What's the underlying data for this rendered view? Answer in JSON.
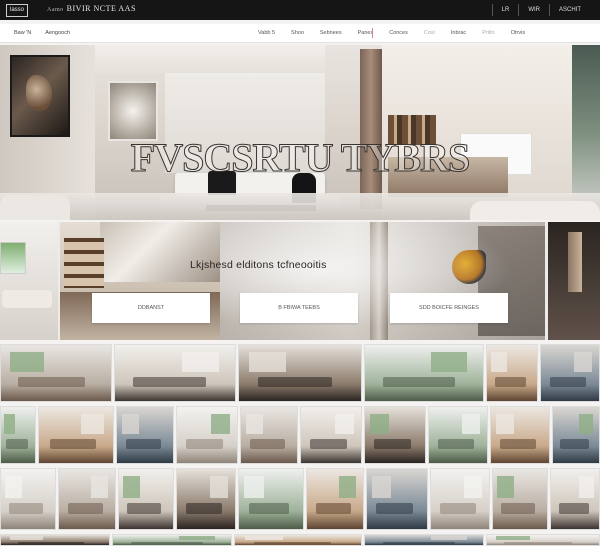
{
  "topbar": {
    "logo": "lasso",
    "brand_sub": "Aamo",
    "brand": "BIVIR NCTE AAS",
    "links": [
      "LR",
      "WIR",
      "ASCHIT"
    ]
  },
  "navbar": {
    "left": [
      "Baw 'N",
      "Aengooch"
    ],
    "items": [
      {
        "label": "Vabb 5",
        "dim": false
      },
      {
        "label": "Shoo",
        "dim": false
      },
      {
        "label": "Sebnees",
        "dim": false
      },
      {
        "label": "Panes",
        "dim": false
      },
      {
        "label": "Conces",
        "dim": false
      },
      {
        "label": "Cosi",
        "dim": true
      },
      {
        "label": "Inbrac",
        "dim": false
      },
      {
        "label": "Priito",
        "dim": true
      },
      {
        "label": "Otrvis",
        "dim": false
      }
    ]
  },
  "hero": {
    "title": "Fvscsrtu tybrs"
  },
  "feature": {
    "title": "Lkjshesd elditons tcfneooitis",
    "cta": [
      "DDBANST",
      "B FBIWA TEEBS",
      "SDD BOICFE REINGES"
    ]
  },
  "colors": {
    "topbar_bg": "#151515",
    "page_bg": "#f4f3f1",
    "accent_separator": "#cc8888"
  }
}
